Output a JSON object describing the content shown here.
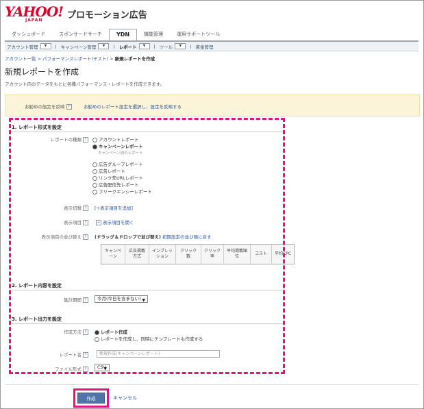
{
  "brand": {
    "logo": "YAHOO!",
    "sub": "JAPAN",
    "product": "プロモーション広告"
  },
  "tabs": [
    "ダッシュボード",
    "スポンサードサーチ",
    "YDN",
    "機能管理",
    "運用サポートツール"
  ],
  "subnav": [
    "アカウント管理",
    "キャンペーン管理",
    "レポート",
    "ツール",
    "資金管理"
  ],
  "breadcrumb": {
    "items": [
      "アカウント一覧",
      "パフォーマンスレポート(テスト)"
    ],
    "current": "新規レポートを作成",
    "sep": ">"
  },
  "page": {
    "title": "新規レポートを作成",
    "desc": "アカウント内のデータをもとに各種パフォーマンス・レポートを作成できます。"
  },
  "recommend": {
    "label": "お勧めの設定を反映",
    "link": "お勧めのレポート設定を選択し、設定を反映する"
  },
  "section1": {
    "title": "1. レポート形式を設定",
    "type_label": "レポートの種類",
    "types": [
      "アカウントレポート",
      "キャンペーンレポート",
      "広告グループレポート",
      "広告レポート",
      "リンク先URLレポート",
      "広告配信先レポート",
      "フリークエンシーレポート"
    ],
    "type_note": "キャンペーン別のレポート",
    "display_label": "表示切替",
    "display_link": "[+表示項目を追加]",
    "items_label": "表示項目",
    "items_link": "表示項目を開く",
    "order_label": "表示項目の並び替え",
    "order_hint": "(ドラッグ＆ドロップで並び替え)",
    "order_reset": "初期設定の並び順に戻す",
    "columns": [
      "キャンペーン",
      "広告掲載方式",
      "インプレッション",
      "クリック数",
      "クリック率",
      "平均掲載順位",
      "コスト",
      "平均CPC"
    ]
  },
  "section2": {
    "title": "2. レポート内容を設定",
    "period_label": "集計期間",
    "period_value": "今月(今日を含まない)"
  },
  "section3": {
    "title": "3. レポート出力を設定",
    "method_label": "作成方法",
    "methods": [
      "レポート作成",
      "レポートを作成し、同時にテンプレートも作成する"
    ],
    "name_label": "レポート名",
    "name_placeholder": "新規作成(キャンペーンレポート)",
    "format_label": "ファイル形式",
    "format_value": "CSV"
  },
  "actions": {
    "create": "作成",
    "cancel": "キャンセル"
  },
  "colors": {
    "highlight": "#e0147d",
    "link": "#2a55a0",
    "brand": "#e0002b"
  }
}
